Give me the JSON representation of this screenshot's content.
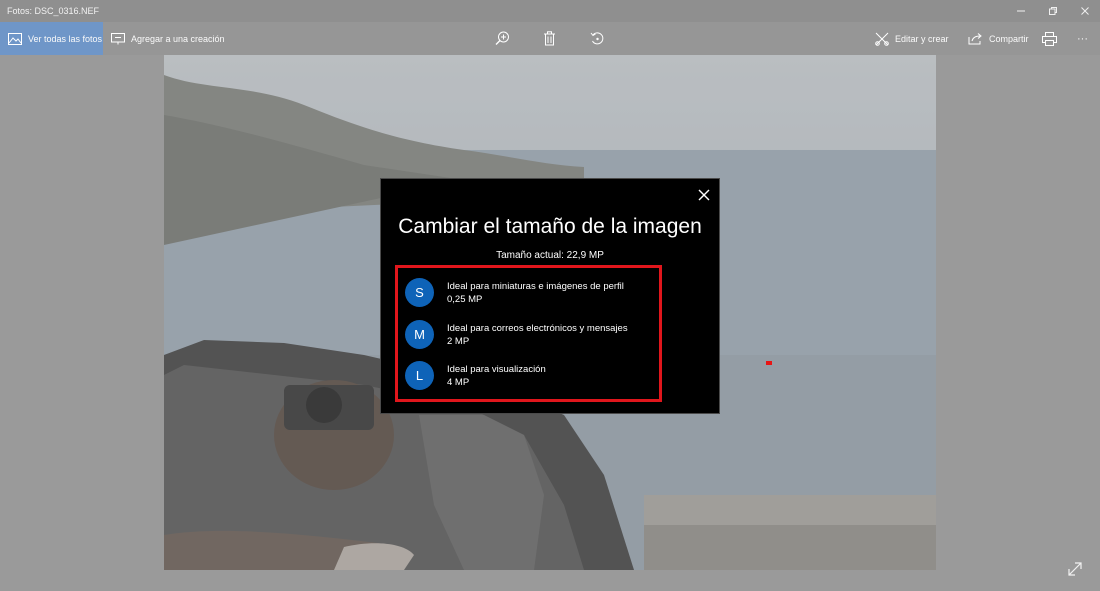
{
  "window": {
    "title": "Fotos: DSC_0316.NEF"
  },
  "toolbar": {
    "see_all_label": "Ver todas las fotos",
    "add_creation_label": "Agregar a una creación",
    "edit_create_label": "Editar y crear",
    "share_label": "Compartir",
    "more_label": "···"
  },
  "dialog": {
    "title": "Cambiar el tamaño de la imagen",
    "current_size": "Tamaño actual: 22,9 MP",
    "options": [
      {
        "badge": "S",
        "description": "Ideal para miniaturas e imágenes de perfil",
        "size": "0,25 MP"
      },
      {
        "badge": "M",
        "description": "Ideal para correos electrónicos y mensajes",
        "size": "2 MP"
      },
      {
        "badge": "L",
        "description": "Ideal para visualización",
        "size": "4 MP"
      }
    ]
  },
  "colors": {
    "accent": "#6f96c8",
    "badge": "#0e63b8",
    "highlight": "#e0161c"
  }
}
